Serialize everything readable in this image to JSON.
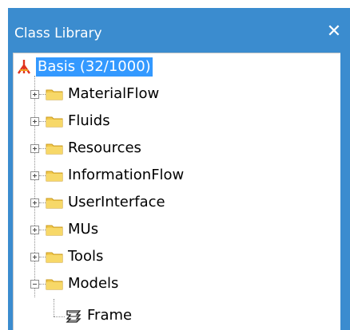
{
  "window": {
    "title": "Class Library",
    "close_glyph": "✕"
  },
  "tree": {
    "root": {
      "label": "Basis (32/1000)",
      "icon": "basis-root-icon",
      "selected": true
    },
    "folders": [
      {
        "label": "MaterialFlow",
        "expanded": false
      },
      {
        "label": "Fluids",
        "expanded": false
      },
      {
        "label": "Resources",
        "expanded": false
      },
      {
        "label": "InformationFlow",
        "expanded": false
      },
      {
        "label": "UserInterface",
        "expanded": false
      },
      {
        "label": "MUs",
        "expanded": false
      },
      {
        "label": "Tools",
        "expanded": false
      },
      {
        "label": "Models",
        "expanded": true
      }
    ],
    "model_children": [
      {
        "label": "Frame",
        "icon": "frame-icon"
      }
    ]
  },
  "colors": {
    "title_bar": "#3b8ccf",
    "selection": "#3399ff",
    "folder": "#f2c94c"
  }
}
